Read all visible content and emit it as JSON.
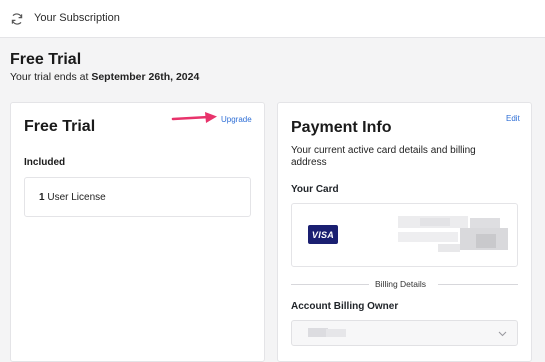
{
  "topbar": {
    "title": "Your Subscription",
    "icon": "refresh-icon"
  },
  "header": {
    "title": "Free Trial",
    "subtitle_prefix": "Your trial ends at ",
    "subtitle_date": "September 26th, 2024"
  },
  "trial_card": {
    "title": "Free Trial",
    "upgrade_label": "Upgrade",
    "included_label": "Included",
    "license_count": "1",
    "license_text": "User License"
  },
  "payment_card": {
    "title": "Payment Info",
    "edit_label": "Edit",
    "description": "Your current active card details and billing address",
    "your_card_label": "Your Card",
    "card_brand": "VISA",
    "billing_details_label": "Billing Details",
    "owner_label": "Account Billing Owner"
  },
  "colors": {
    "link": "#2f6fd6",
    "annotation_arrow": "#e8336b",
    "visa": "#1a1f71"
  }
}
